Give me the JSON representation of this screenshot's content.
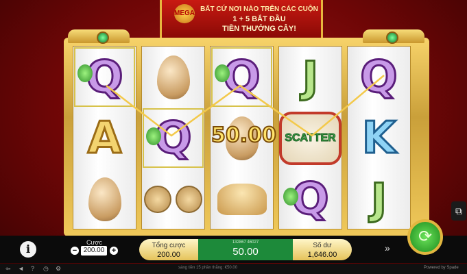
{
  "banner": {
    "logo": "MEGA",
    "line1": "BẤT CỨ NƠI NÀO TRÊN CÁC CUỘN",
    "line2": "1 + 5 BẮT ĐẦU",
    "line3": "TIỀN THƯỞNG CÂY!"
  },
  "reels": [
    [
      "Q",
      "A",
      "egg"
    ],
    [
      "egg",
      "Q",
      "coins"
    ],
    [
      "Q",
      "egg",
      "ingot"
    ],
    [
      "J",
      "SCATTER",
      "Q"
    ],
    [
      "Q",
      "K",
      "J"
    ]
  ],
  "win_overlay": "50.00",
  "controls": {
    "bet_label": "Cược",
    "bet_value": "200.00",
    "minus": "−",
    "plus": "+",
    "total_bet_label": "Tổng cược",
    "total_bet_value": "200.00",
    "win_id": "132867 46027",
    "win_value": "50.00",
    "balance_label": "Số dư",
    "balance_value": "1,646.00",
    "info_symbol": "i",
    "spin_symbol": "⟳",
    "turbo_symbol": "»",
    "autoplay_symbol": "⧉"
  },
  "footer": {
    "coins_text": "sáng tiền 15 phần thắng: €50.00",
    "powered": "Powered by Spade"
  },
  "colors": {
    "background": "#7a0808",
    "frame_gold": "#e0b94a",
    "win_green": "#1d8a3a"
  }
}
